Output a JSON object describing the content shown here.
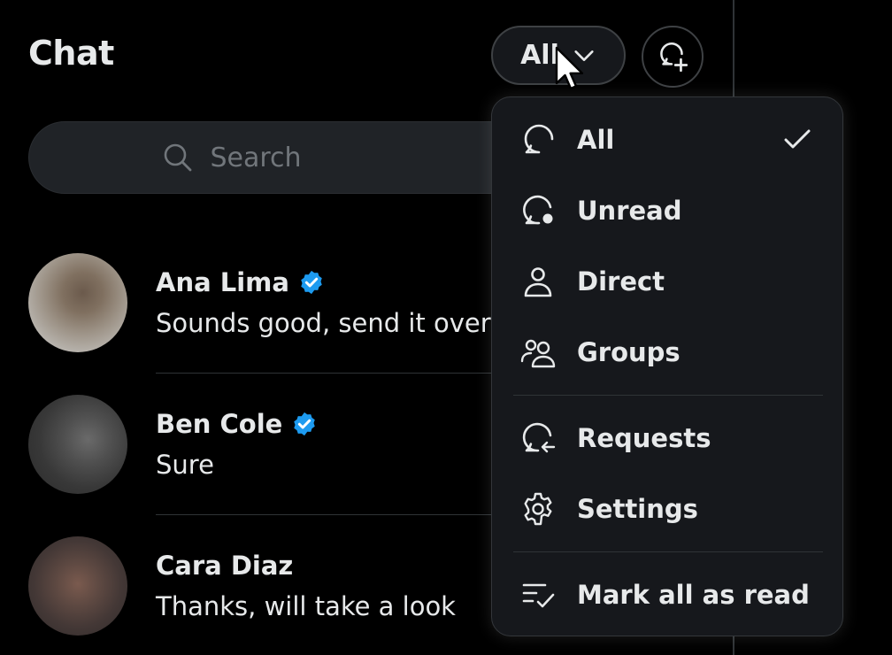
{
  "header": {
    "title": "Chat",
    "filter_label": "All"
  },
  "search": {
    "placeholder": "Search"
  },
  "conversations": [
    {
      "name": "Ana Lima",
      "verified": true,
      "message": "Sounds good, send it over"
    },
    {
      "name": "Ben Cole",
      "verified": true,
      "message": "Sure"
    },
    {
      "name": "Cara Diaz",
      "verified": false,
      "message": "Thanks, will take a look"
    }
  ],
  "filter_menu": {
    "items": [
      {
        "label": "All",
        "icon": "chat-bubble-icon",
        "selected": true
      },
      {
        "label": "Unread",
        "icon": "chat-bubble-unread-icon"
      },
      {
        "label": "Direct",
        "icon": "person-icon"
      },
      {
        "label": "Groups",
        "icon": "people-icon"
      },
      {
        "label": "Requests",
        "icon": "chat-request-icon"
      },
      {
        "label": "Settings",
        "icon": "gear-icon"
      },
      {
        "label": "Mark all as read",
        "icon": "mark-read-icon"
      }
    ]
  },
  "colors": {
    "background": "#000000",
    "text": "#e7e9ea",
    "muted": "#71767b",
    "verified": "#1d9bf0",
    "menu_bg": "#16181c"
  }
}
